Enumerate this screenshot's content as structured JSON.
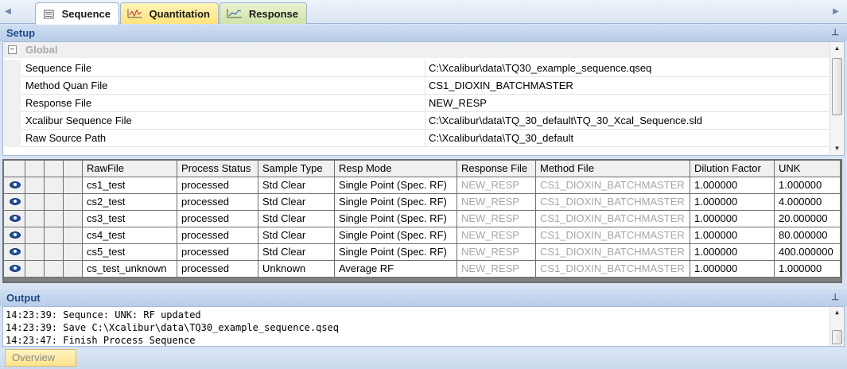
{
  "tabs": [
    {
      "label": "Sequence",
      "icon": "sequence-grid-icon"
    },
    {
      "label": "Quantitation",
      "icon": "quantitation-chart-icon"
    },
    {
      "label": "Response",
      "icon": "response-chart-icon"
    }
  ],
  "setup": {
    "title": "Setup",
    "group": "Global",
    "properties": [
      {
        "name": "Sequence File",
        "value": "C:\\Xcalibur\\data\\TQ30_example_sequence.qseq"
      },
      {
        "name": "Method Quan File",
        "value": "CS1_DIOXIN_BATCHMASTER"
      },
      {
        "name": "Response File",
        "value": "NEW_RESP"
      },
      {
        "name": "Xcalibur Sequence File",
        "value": "C:\\Xcalibur\\data\\TQ_30_default\\TQ_30_Xcal_Sequence.sld"
      },
      {
        "name": "Raw Source Path",
        "value": "C:\\Xcalibur\\data\\TQ_30_default"
      }
    ]
  },
  "sequence_grid": {
    "columns": [
      "RawFile",
      "Process Status",
      "Sample Type",
      "Resp Mode",
      "Response File",
      "Method File",
      "Dilution Factor",
      "UNK"
    ],
    "rows": [
      [
        "cs1_test",
        "processed",
        "Std Clear",
        "Single Point (Spec. RF)",
        "NEW_RESP",
        "CS1_DIOXIN_BATCHMASTER",
        "1.000000",
        "1.000000"
      ],
      [
        "cs2_test",
        "processed",
        "Std Clear",
        "Single Point (Spec. RF)",
        "NEW_RESP",
        "CS1_DIOXIN_BATCHMASTER",
        "1.000000",
        "4.000000"
      ],
      [
        "cs3_test",
        "processed",
        "Std Clear",
        "Single Point (Spec. RF)",
        "NEW_RESP",
        "CS1_DIOXIN_BATCHMASTER",
        "1.000000",
        "20.000000"
      ],
      [
        "cs4_test",
        "processed",
        "Std Clear",
        "Single Point (Spec. RF)",
        "NEW_RESP",
        "CS1_DIOXIN_BATCHMASTER",
        "1.000000",
        "80.000000"
      ],
      [
        "cs5_test",
        "processed",
        "Std Clear",
        "Single Point (Spec. RF)",
        "NEW_RESP",
        "CS1_DIOXIN_BATCHMASTER",
        "1.000000",
        "400.000000"
      ],
      [
        "cs_test_unknown",
        "processed",
        "Unknown",
        "Average RF",
        "NEW_RESP",
        "CS1_DIOXIN_BATCHMASTER",
        "1.000000",
        "1.000000"
      ]
    ]
  },
  "output": {
    "title": "Output",
    "lines": [
      "14:23:39: Sequnce: UNK: RF updated",
      "14:23:39: Save C:\\Xcalibur\\data\\TQ30_example_sequence.qseq",
      "14:23:47: Finish Process Sequence"
    ]
  },
  "bottom_tabs": [
    "Overview"
  ],
  "colors": {
    "panel_header_text": "#1e4a8a",
    "disabled_text": "#a6a6a6",
    "eye_icon": "#1f4fa3"
  }
}
